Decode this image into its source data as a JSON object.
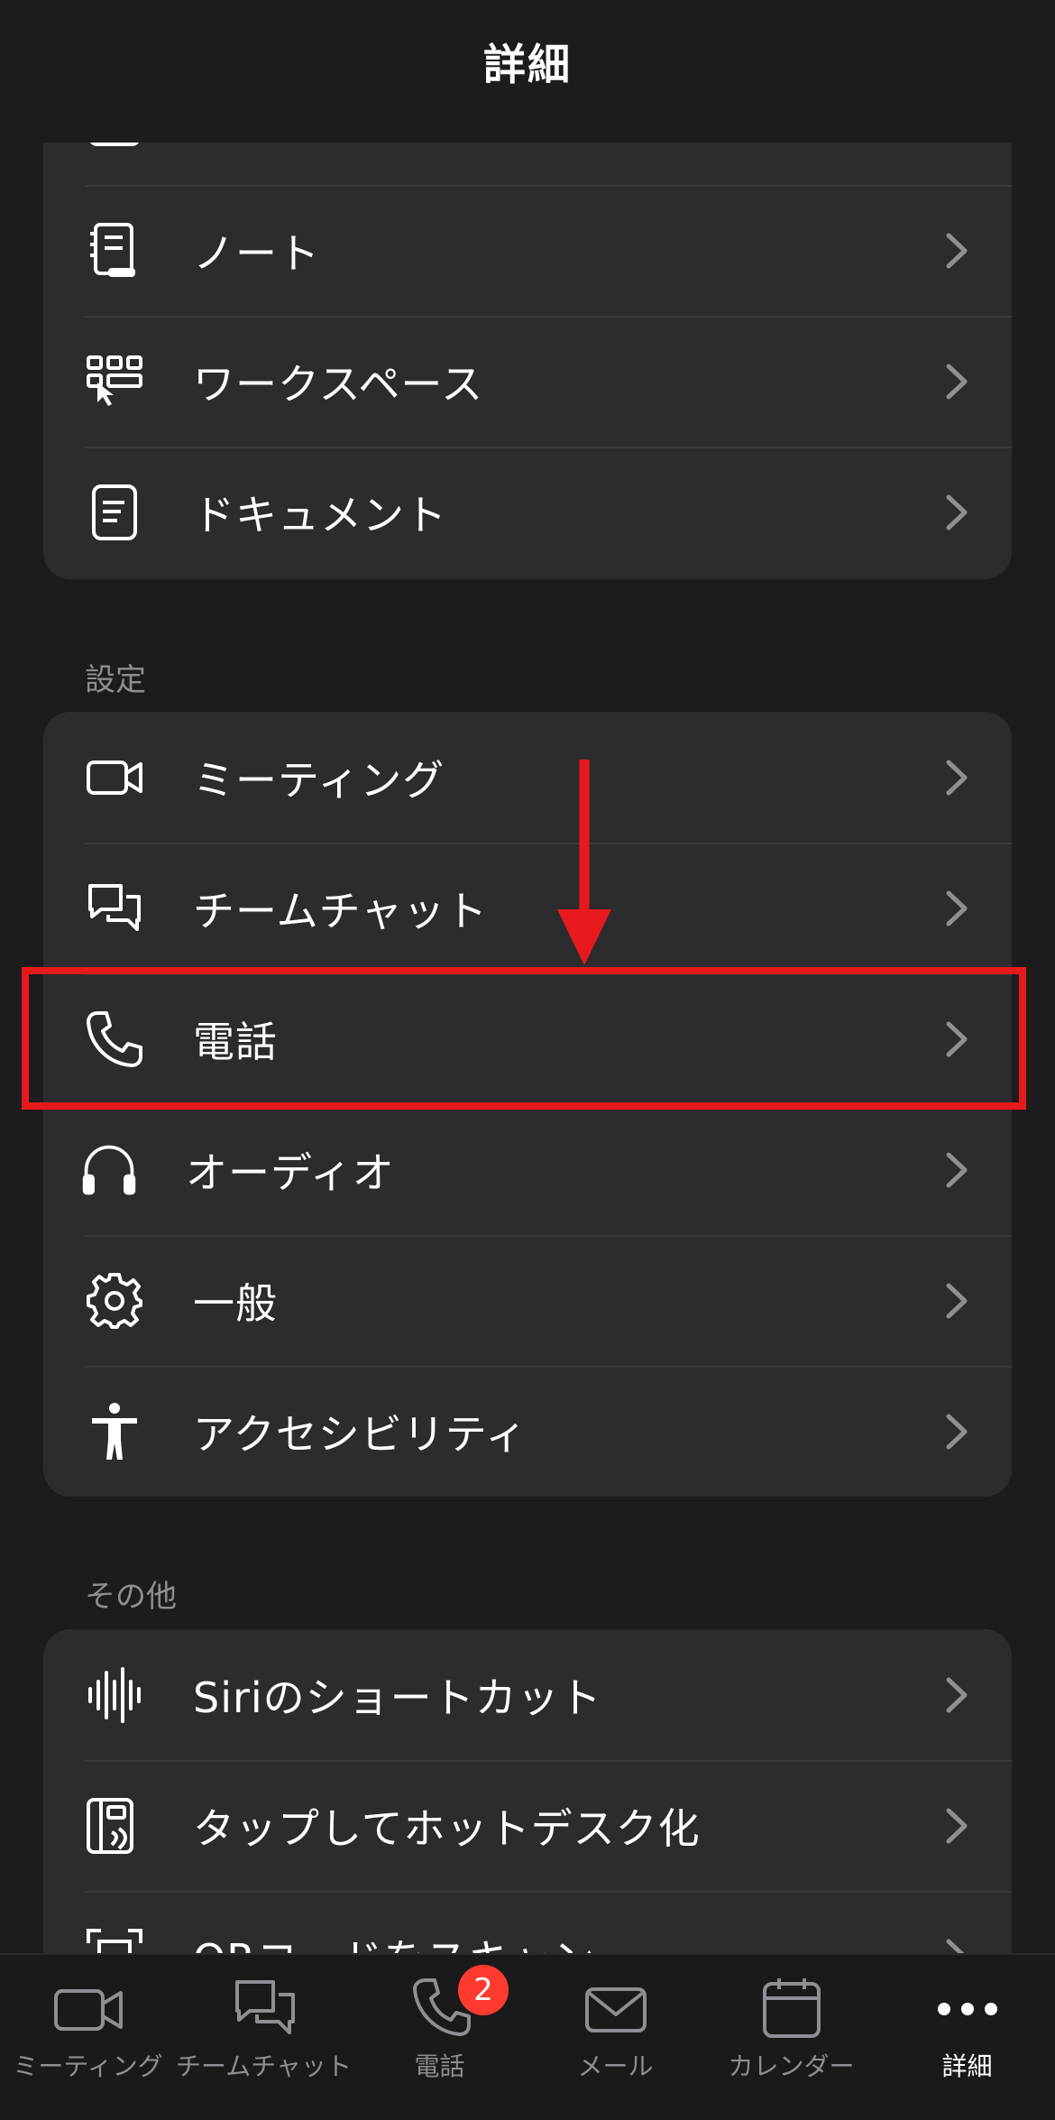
{
  "header": {
    "title": "詳細"
  },
  "top_card": {
    "items": [
      {
        "label": "ノート",
        "icon": "notebook-icon"
      },
      {
        "label": "ワークスペース",
        "icon": "workspace-icon"
      },
      {
        "label": "ドキュメント",
        "icon": "document-icon"
      }
    ]
  },
  "settings": {
    "section_label": "設定",
    "items": [
      {
        "label": "ミーティング",
        "icon": "video-camera-icon"
      },
      {
        "label": "チームチャット",
        "icon": "chat-bubbles-icon"
      },
      {
        "label": "電話",
        "icon": "phone-icon"
      },
      {
        "label": "オーディオ",
        "icon": "headphones-icon"
      },
      {
        "label": "一般",
        "icon": "gear-icon"
      },
      {
        "label": "アクセシビリティ",
        "icon": "accessibility-icon"
      }
    ]
  },
  "other": {
    "section_label": "その他",
    "items": [
      {
        "label": "Siriのショートカット",
        "icon": "waveform-icon"
      },
      {
        "label": "タップしてホットデスク化",
        "icon": "hot-desk-icon"
      },
      {
        "label": "QRコードをスキャン",
        "icon": "qr-code-icon"
      }
    ]
  },
  "tabbar": {
    "tabs": [
      {
        "label": "ミーティング",
        "icon": "video-camera-icon"
      },
      {
        "label": "チームチャット",
        "icon": "chat-bubbles-icon"
      },
      {
        "label": "電話",
        "icon": "phone-icon",
        "badge": "2"
      },
      {
        "label": "メール",
        "icon": "mail-icon"
      },
      {
        "label": "カレンダー",
        "icon": "calendar-icon"
      },
      {
        "label": "詳細",
        "icon": "more-icon",
        "active": true
      }
    ]
  },
  "colors": {
    "background": "#1c1c1e",
    "card": "#2c2c2e",
    "highlight": "#e8191c",
    "badge": "#ff3b30"
  }
}
